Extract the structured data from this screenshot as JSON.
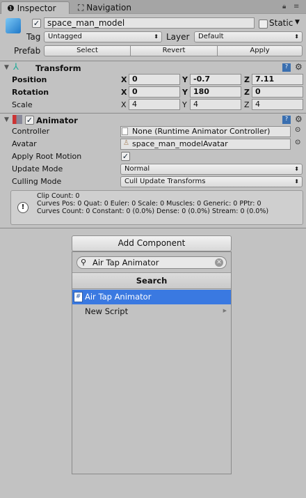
{
  "tabs": [
    {
      "label": "Inspector",
      "icon": "info-icon",
      "active": true
    },
    {
      "label": "Navigation",
      "icon": "navigation-icon",
      "active": false
    }
  ],
  "object": {
    "active": true,
    "name": "space_man_model",
    "static_label": "Static",
    "static": false,
    "tag_label": "Tag",
    "tag": "Untagged",
    "layer_label": "Layer",
    "layer": "Default",
    "prefab_label": "Prefab",
    "prefab_buttons": [
      "Select",
      "Revert",
      "Apply"
    ]
  },
  "transform": {
    "title": "Transform",
    "rows": [
      {
        "label": "Position",
        "x": "0",
        "y": "-0.7",
        "z": "7.11"
      },
      {
        "label": "Rotation",
        "x": "0",
        "y": "180",
        "z": "0"
      },
      {
        "label": "Scale",
        "x": "4",
        "y": "4",
        "z": "4"
      }
    ],
    "axes": [
      "X",
      "Y",
      "Z"
    ]
  },
  "animator": {
    "title": "Animator",
    "enabled": true,
    "controller_label": "Controller",
    "controller": "None (Runtime Animator Controller)",
    "avatar_label": "Avatar",
    "avatar": "space_man_modelAvatar",
    "root_motion_label": "Apply Root Motion",
    "root_motion": true,
    "update_mode_label": "Update Mode",
    "update_mode": "Normal",
    "culling_mode_label": "Culling Mode",
    "culling_mode": "Cull Update Transforms",
    "info": [
      "Clip Count: 0",
      "Curves Pos: 0 Quat: 0 Euler: 0 Scale: 0 Muscles: 0 Generic: 0 PPtr: 0",
      "Curves Count: 0 Constant: 0 (0.0%) Dense: 0 (0.0%) Stream: 0 (0.0%)"
    ]
  },
  "add_component": {
    "label": "Add Component",
    "search_value": "Air Tap Animator",
    "section": "Search",
    "items": [
      {
        "label": "Air Tap Animator",
        "selected": true
      },
      {
        "label": "New Script",
        "submenu": true
      }
    ]
  },
  "colors": {
    "selection": "#3a79e1",
    "background": "#c2c2c2"
  }
}
